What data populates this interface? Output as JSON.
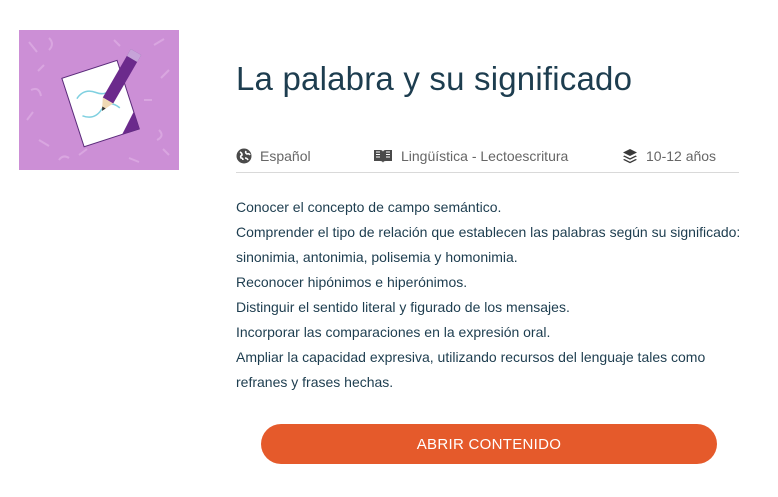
{
  "card": {
    "title": "La palabra y su significado",
    "meta": {
      "language": "Español",
      "subject": "Lingüística - Lectoescritura",
      "age": "10-12 años"
    },
    "objectives": [
      "Conocer el concepto de campo semántico.",
      "Comprender el tipo de relación que establecen las palabras según su significado:",
      "sinonimia, antonimia, polisemia y homonimia.",
      "Reconocer hipónimos e hiperónimos.",
      "Distinguir el sentido literal y figurado de los mensajes.",
      "Incorporar las comparaciones en la expresión oral.",
      "Ampliar la capacidad expresiva, utilizando recursos del lenguaje tales como",
      "refranes y frases hechas."
    ],
    "cta_label": "ABRIR CONTENIDO"
  },
  "colors": {
    "thumbnail_bg": "#cc8fd6",
    "title": "#1d3d4f",
    "cta": "#e55a2b",
    "pencil": "#6b2a8c"
  },
  "icons": {
    "thumbnail": "paper-pencil-icon",
    "language": "globe-icon",
    "subject": "open-book-icon",
    "age": "layers-icon"
  }
}
